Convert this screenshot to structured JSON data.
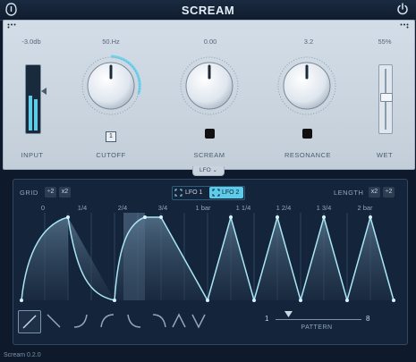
{
  "app": {
    "title": "SCREAM",
    "version": "Scream 0.2.0"
  },
  "colors": {
    "accent": "#5ecbe8",
    "panel": "#cfd9e3",
    "dark_bg": "#14243a"
  },
  "controls": {
    "input": {
      "value": "-3.0db",
      "label": "INPUT",
      "level": 0.55
    },
    "cutoff": {
      "value": "50.Hz",
      "label": "CUTOFF",
      "badge": "1"
    },
    "scream": {
      "value": "0.00",
      "label": "SCREAM"
    },
    "resonance": {
      "value": "3.2",
      "label": "RESONANCE"
    },
    "wet": {
      "value": "55%",
      "label": "WET",
      "level": 0.55
    }
  },
  "lfo_tab": {
    "label": "LFO"
  },
  "lfo": {
    "grid_label": "GRID",
    "grid_div": "÷2",
    "grid_mul": "x2",
    "lfo1": "LFO 1",
    "lfo2": "LFO 2",
    "length_label": "LENGTH",
    "length_mul": "x2",
    "length_div": "÷2",
    "ticks": [
      "0",
      "1/4",
      "2/4",
      "3/4",
      "1 bar",
      "1 1/4",
      "1 2/4",
      "1 3/4",
      "2 bar"
    ],
    "pattern": {
      "label": "PATTERN",
      "min": "1",
      "max": "8",
      "value": 2
    }
  },
  "shapes": [
    "line-shape-icon",
    "decay-shape-icon",
    "curve-up-shape-icon",
    "curve-down-shape-icon",
    "s-curve-shape-icon",
    "reverse-curve-shape-icon",
    "triangle-shape-icon",
    "v-shape-icon"
  ]
}
